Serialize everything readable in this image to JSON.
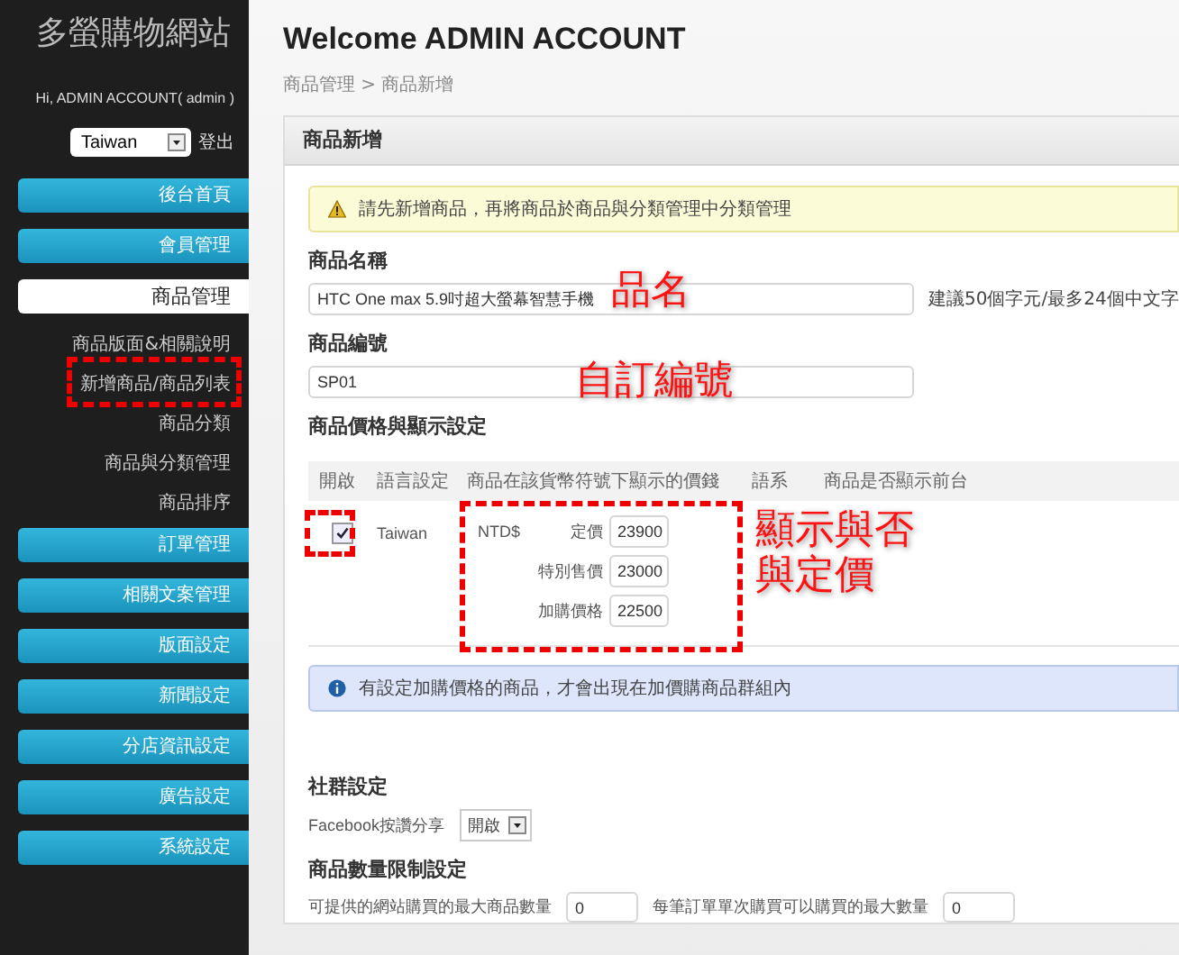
{
  "sidebar": {
    "site_title": "多螢購物網站",
    "greeting": "Hi, ADMIN ACCOUNT( admin )",
    "language_select": {
      "value": "Taiwan"
    },
    "logout": "登出",
    "menu": [
      {
        "label": "後台首頁",
        "selected": false
      },
      {
        "label": "會員管理",
        "selected": false
      },
      {
        "label": "商品管理",
        "selected": true,
        "children": [
          {
            "label": "商品版面&相關說明",
            "selected": false,
            "highlighted": false
          },
          {
            "label": "新增商品/商品列表",
            "selected": false,
            "highlighted": true
          },
          {
            "label": "商品分類",
            "selected": false,
            "highlighted": false
          },
          {
            "label": "商品與分類管理",
            "selected": false,
            "highlighted": false
          },
          {
            "label": "商品排序",
            "selected": false,
            "highlighted": false
          }
        ]
      },
      {
        "label": "訂單管理",
        "selected": false
      },
      {
        "label": "相關文案管理",
        "selected": false
      },
      {
        "label": "版面設定",
        "selected": false
      },
      {
        "label": "新聞設定",
        "selected": false
      },
      {
        "label": "分店資訊設定",
        "selected": false
      },
      {
        "label": "廣告設定",
        "selected": false
      },
      {
        "label": "系統設定",
        "selected": false
      }
    ]
  },
  "header": {
    "title": "Welcome ADMIN ACCOUNT",
    "breadcrumb": "商品管理 > 商品新增"
  },
  "panel": {
    "title": "商品新增",
    "warning": "請先新增商品，再將商品於商品與分類管理中分類管理",
    "product_name": {
      "label": "商品名稱",
      "value": "HTC One max 5.9吋超大螢幕智慧手機",
      "hint": "建議50個字元/最多24個中文字",
      "annotation": "品名"
    },
    "product_code": {
      "label": "商品編號",
      "value": "SP01",
      "annotation": "自訂編號"
    },
    "price_section": {
      "title": "商品價格與顯示設定",
      "columns": [
        "開啟",
        "語言設定",
        "商品在該貨幣符號下顯示的價錢",
        "語系",
        "商品是否顯示前台"
      ],
      "rows": [
        {
          "enabled": true,
          "highlighted": true,
          "language": "Taiwan",
          "currency": "NTD$",
          "prices": [
            {
              "label": "定價",
              "value": "23900"
            },
            {
              "label": "特別售價",
              "value": "23000"
            },
            {
              "label": "加購價格",
              "value": "22500"
            }
          ],
          "annotation": [
            "顯示與否",
            "與定價"
          ]
        }
      ]
    },
    "info": "有設定加購價格的商品，才會出現在加價購商品群組內",
    "social": {
      "title": "社群設定",
      "facebook_label": "Facebook按讚分享",
      "facebook_value": "開啟"
    },
    "quantity": {
      "title": "商品數量限制設定",
      "max_site_label": "可提供的網站購買的最大商品數量",
      "max_site_value": "0",
      "max_order_label": "每筆訂單單次購買可以購買的最大數量",
      "max_order_value": "0"
    }
  }
}
